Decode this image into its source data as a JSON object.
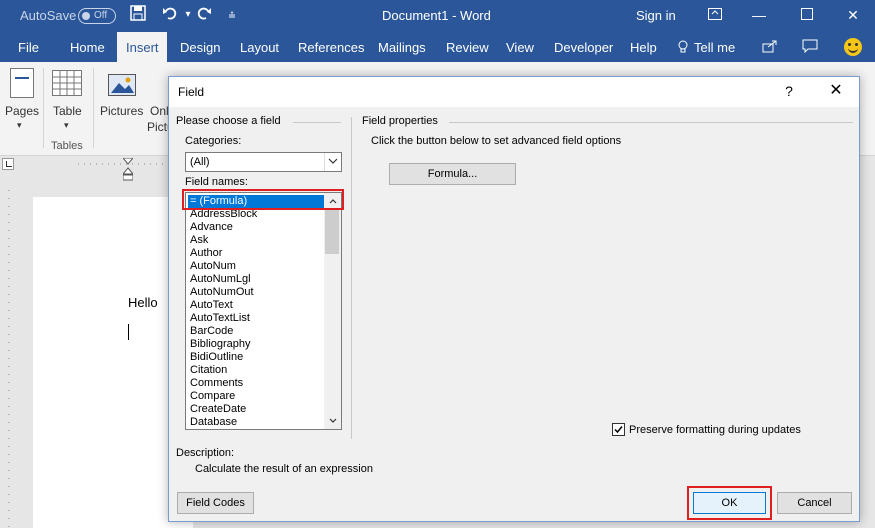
{
  "titlebar": {
    "autosave": "AutoSave",
    "autosave_state": "Off",
    "title": "Document1 - Word",
    "signin": "Sign in"
  },
  "menu": {
    "items": [
      "File",
      "Home",
      "Insert",
      "Design",
      "Layout",
      "References",
      "Mailings",
      "Review",
      "View",
      "Developer",
      "Help",
      "Tell me"
    ],
    "active": "Insert"
  },
  "ribbon": {
    "pages": "Pages",
    "table": "Table",
    "tables_group": "Tables",
    "pictures": "Pictures",
    "online": "Onl",
    "pictures_trunc": "Pictu"
  },
  "document": {
    "text": "Hello"
  },
  "dialog": {
    "title": "Field",
    "help": "?",
    "choose_title": "Please choose a field",
    "categories_label": "Categories:",
    "categories_value": "(All)",
    "field_names_label": "Field names:",
    "field_names": [
      "= (Formula)",
      "AddressBlock",
      "Advance",
      "Ask",
      "Author",
      "AutoNum",
      "AutoNumLgl",
      "AutoNumOut",
      "AutoText",
      "AutoTextList",
      "BarCode",
      "Bibliography",
      "BidiOutline",
      "Citation",
      "Comments",
      "Compare",
      "CreateDate",
      "Database"
    ],
    "selected_index": 0,
    "properties_title": "Field properties",
    "properties_hint": "Click the button below to set advanced field options",
    "formula_button": "Formula...",
    "preserve_label": "Preserve formatting during updates",
    "preserve_checked": true,
    "description_label": "Description:",
    "description_text": "Calculate the result of an expression",
    "field_codes_button": "Field Codes",
    "ok_button": "OK",
    "cancel_button": "Cancel"
  }
}
